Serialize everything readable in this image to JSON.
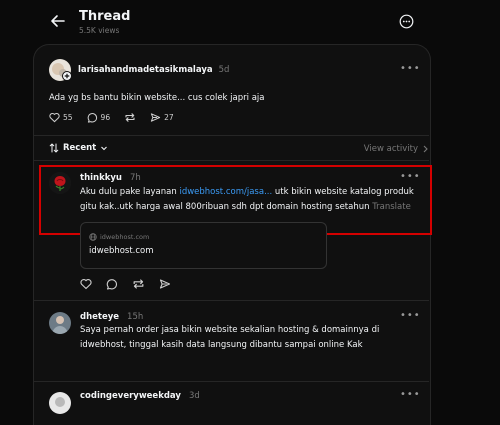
{
  "header": {
    "title": "Thread",
    "views": "5.5K views"
  },
  "original_post": {
    "username": "larisahandmadetasikmalaya",
    "time": "5d",
    "text": "Ada yg bs bantu bikin website... cus colek japri aja",
    "likes": "55",
    "comments": "96",
    "shares": "27"
  },
  "sort": {
    "label": "Recent",
    "view_activity": "View activity"
  },
  "replies": [
    {
      "username": "thinkkyu",
      "time": "7h",
      "text_before": "Aku dulu pake layanan ",
      "link": "idwebhost.com/jasa...",
      "text_after_line1": " utk bikin website katalog produk",
      "text_line2": "gitu kak..utk harga awal 800ribuan sdh dpt domain hosting setahun",
      "translate": "Translate",
      "preview_domain": "idwebhost.com",
      "preview_title": "idwebhost.com"
    },
    {
      "username": "dheteye",
      "time": "15h",
      "line1": "Saya pernah order jasa bikin website sekalian hosting & domainnya di",
      "line2": "idwebhost, tinggal kasih data langsung dibantu sampai online Kak"
    },
    {
      "username": "codingeveryweekday",
      "time": "3d"
    }
  ],
  "colors": {
    "background": "#0a0a0a",
    "card": "#101010",
    "link": "#3b9bf5",
    "highlight": "#d40000"
  }
}
